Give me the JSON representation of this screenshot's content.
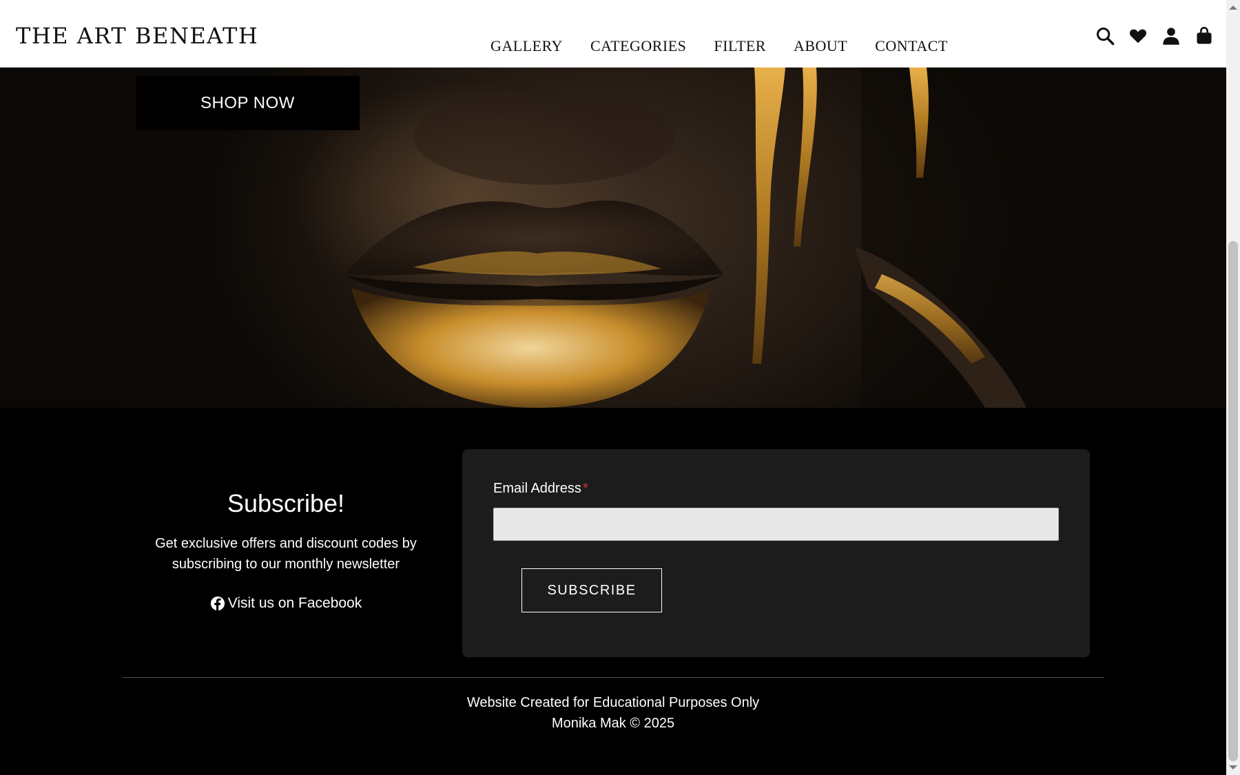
{
  "header": {
    "brand": "THE ART BENEATH",
    "nav": [
      "GALLERY",
      "CATEGORIES",
      "FILTER",
      "ABOUT",
      "CONTACT"
    ],
    "icons": [
      "search-icon",
      "heart-icon",
      "user-icon",
      "shopping-bag-icon"
    ]
  },
  "hero": {
    "shop_label": "SHOP NOW"
  },
  "subscribe": {
    "title": "Subscribe!",
    "description": "Get exclusive offers and discount codes by subscribing to our monthly newsletter",
    "facebook_label": "Visit us on Facebook",
    "email_label": "Email Address",
    "required_mark": "*",
    "email_value": "",
    "button_label": "SUBSCRIBE"
  },
  "footer": {
    "line1": "Website Created for Educational Purposes Only",
    "line2": "Monika Mak © 2025"
  },
  "colors": {
    "header_bg": "#ffffff",
    "page_bg": "#000000",
    "card_bg": "#1c1c1c",
    "accent_gold": "#c8912e",
    "required": "#e0283a"
  }
}
